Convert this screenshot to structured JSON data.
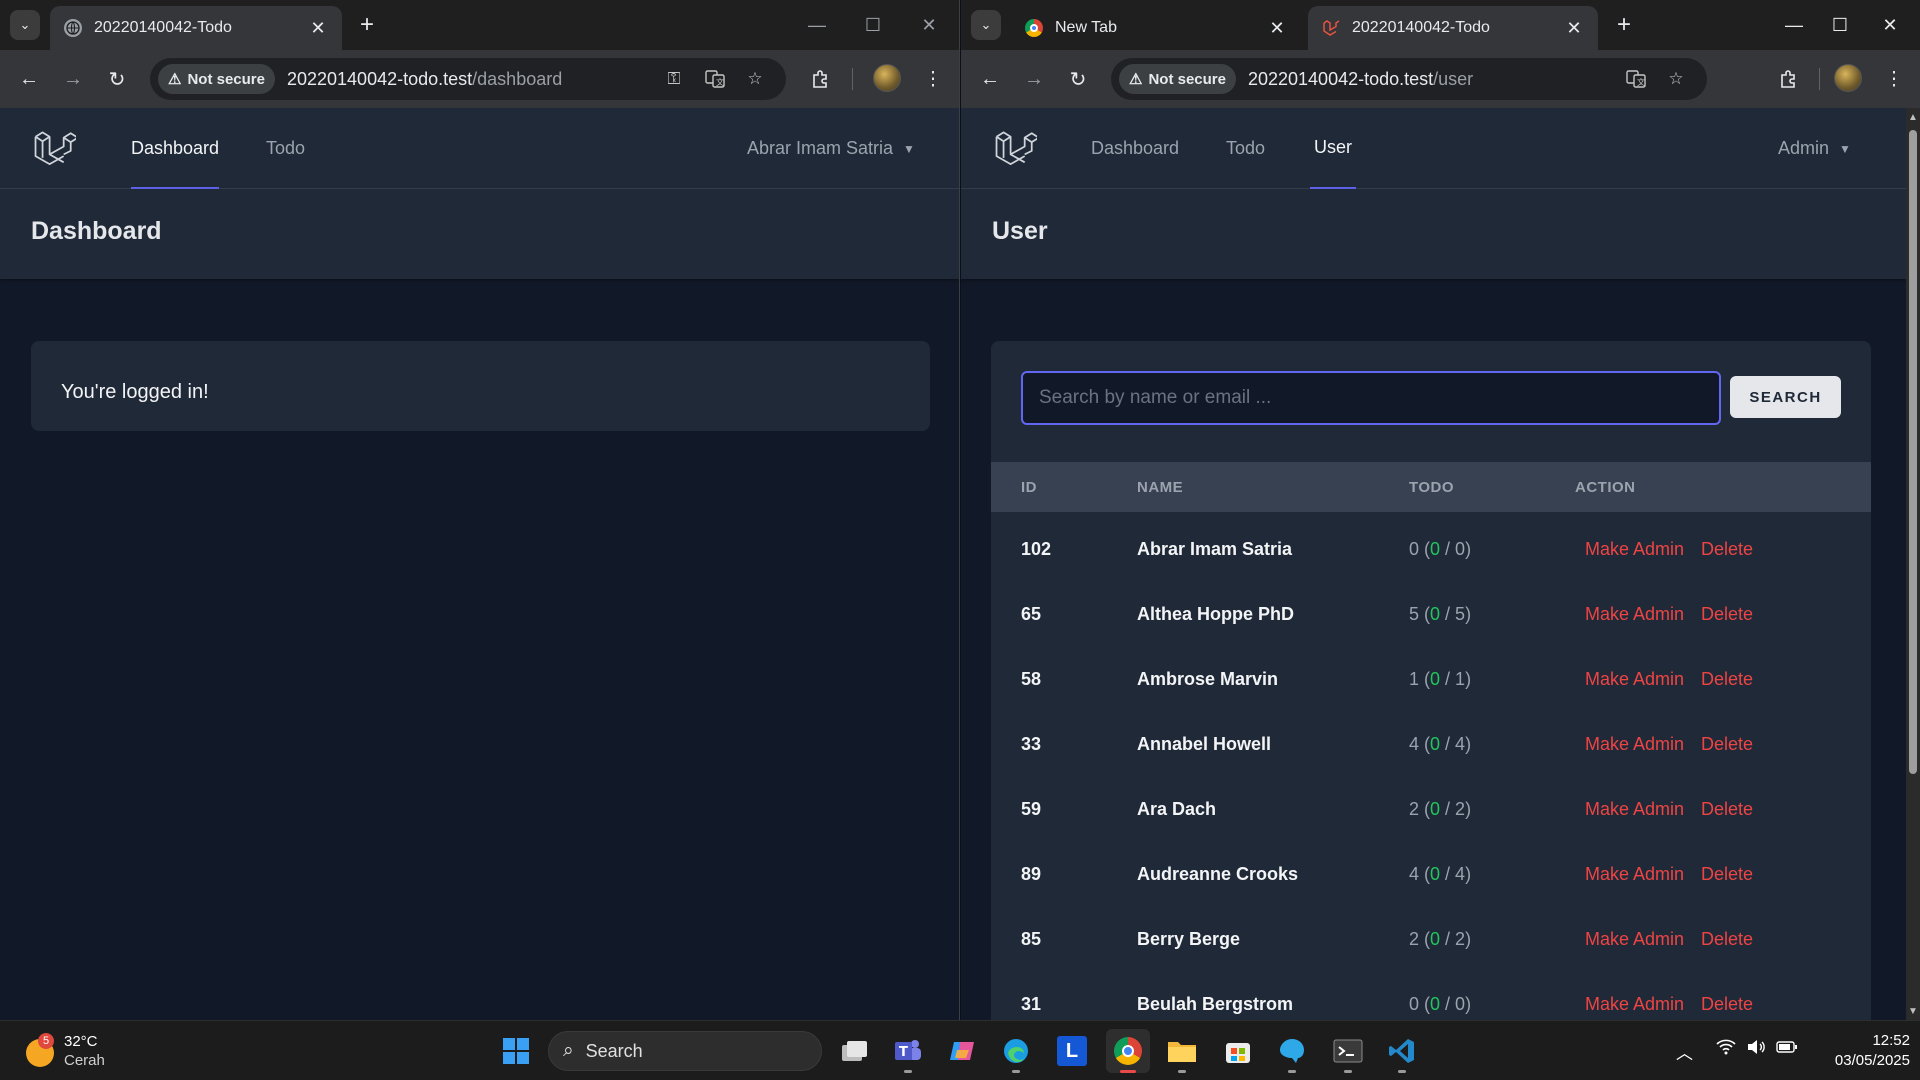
{
  "left_window": {
    "tab": {
      "title": "20220140042-Todo"
    },
    "address": {
      "security": "Not secure",
      "host": "20220140042-todo.test",
      "path": "/dashboard"
    },
    "nav": {
      "links": [
        "Dashboard",
        "Todo"
      ],
      "active": "Dashboard",
      "user": "Abrar Imam Satria"
    },
    "page_title": "Dashboard",
    "message": "You're logged in!"
  },
  "right_window": {
    "tabs": [
      {
        "title": "New Tab"
      },
      {
        "title": "20220140042-Todo"
      }
    ],
    "address": {
      "security": "Not secure",
      "host": "20220140042-todo.test",
      "path": "/user"
    },
    "nav": {
      "links": [
        "Dashboard",
        "Todo",
        "User"
      ],
      "active": "User",
      "user": "Admin"
    },
    "page_title": "User",
    "search": {
      "placeholder": "Search by name or email ...",
      "button": "SEARCH"
    },
    "table": {
      "headers": [
        "ID",
        "NAME",
        "TODO",
        "ACTION"
      ],
      "rows": [
        {
          "id": "102",
          "name": "Abrar Imam Satria",
          "total": "0",
          "done": "0",
          "all": "0"
        },
        {
          "id": "65",
          "name": "Althea Hoppe PhD",
          "total": "5",
          "done": "0",
          "all": "5"
        },
        {
          "id": "58",
          "name": "Ambrose Marvin",
          "total": "1",
          "done": "0",
          "all": "1"
        },
        {
          "id": "33",
          "name": "Annabel Howell",
          "total": "4",
          "done": "0",
          "all": "4"
        },
        {
          "id": "59",
          "name": "Ara Dach",
          "total": "2",
          "done": "0",
          "all": "2"
        },
        {
          "id": "89",
          "name": "Audreanne Crooks",
          "total": "4",
          "done": "0",
          "all": "4"
        },
        {
          "id": "85",
          "name": "Berry Berge",
          "total": "2",
          "done": "0",
          "all": "2"
        },
        {
          "id": "31",
          "name": "Beulah Bergstrom",
          "total": "0",
          "done": "0",
          "all": "0"
        }
      ],
      "actions": {
        "make_admin": "Make Admin",
        "delete": "Delete"
      }
    }
  },
  "taskbar": {
    "weather": {
      "badge": "5",
      "temp": "32°C",
      "condition": "Cerah"
    },
    "search_label": "Search",
    "clock": {
      "time": "12:52",
      "date": "03/05/2025"
    },
    "apps": [
      "start",
      "search",
      "task-view",
      "teams",
      "copilot",
      "edge",
      "l-app",
      "chrome",
      "file-explorer",
      "microsoft-store",
      "app-blue",
      "terminal",
      "vscode"
    ]
  },
  "colors": {
    "accent": "#6366f1",
    "danger": "#ef4444",
    "success": "#22c55e",
    "page_bg": "#111827",
    "surface": "#1f2937"
  }
}
